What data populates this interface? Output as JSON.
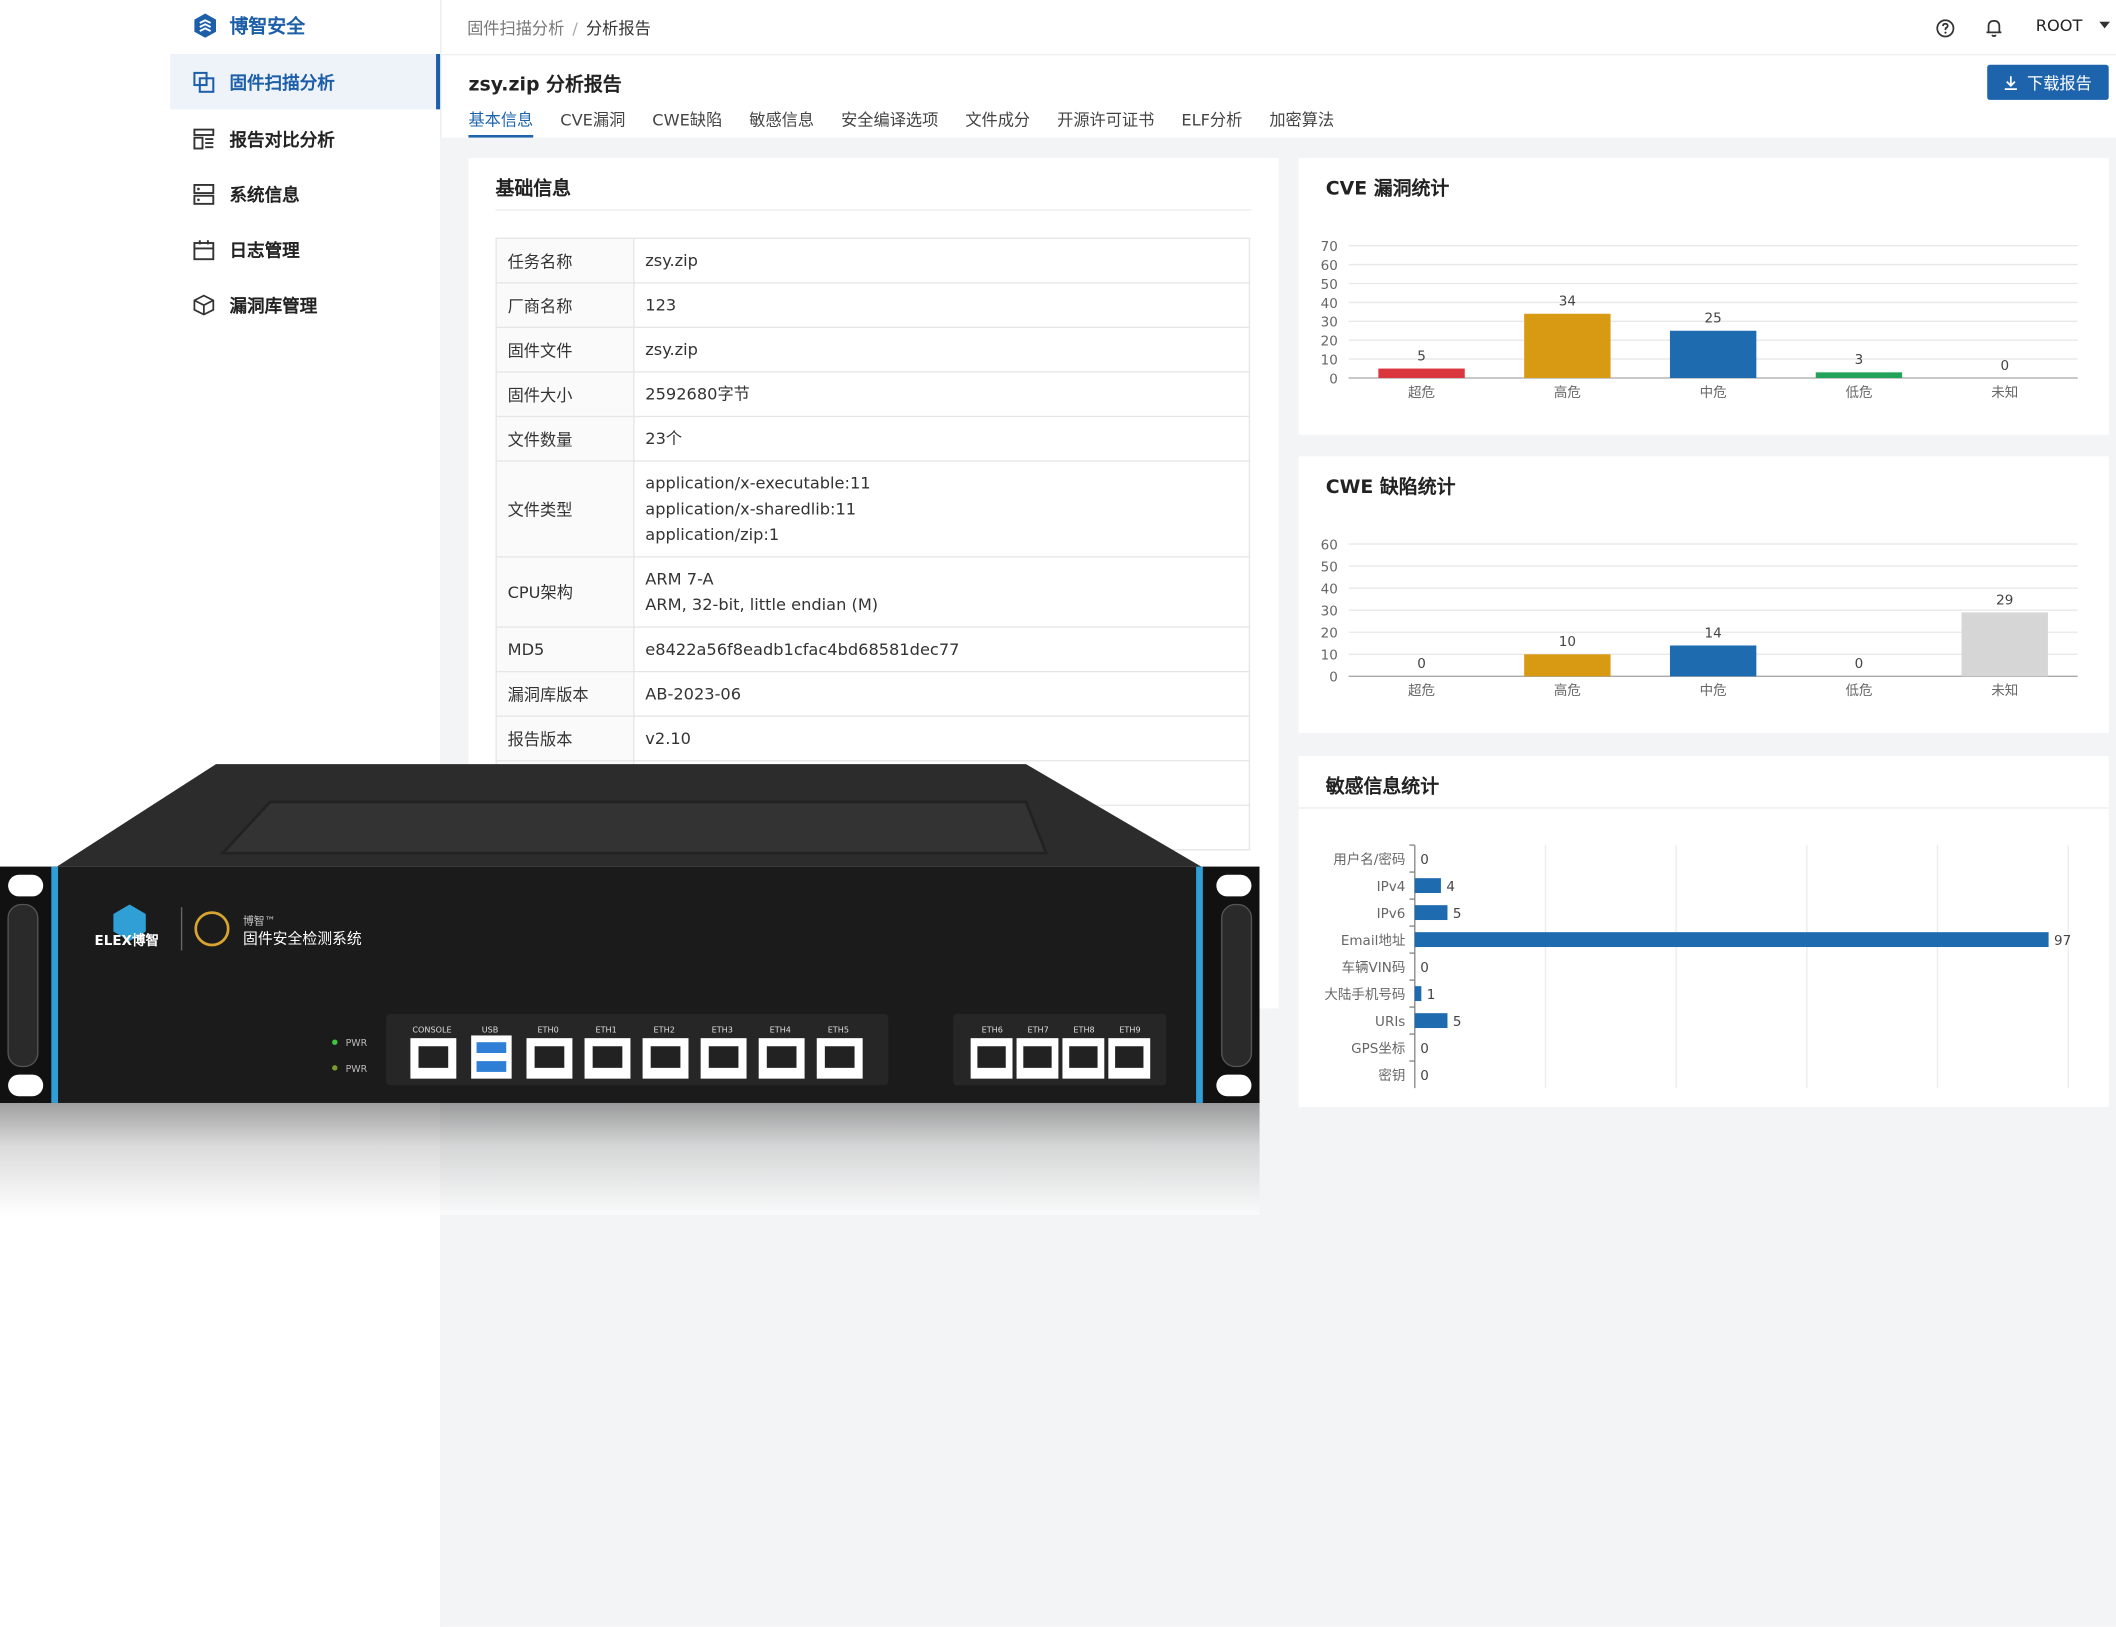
{
  "app": {
    "name": "博智安全"
  },
  "sidebar": {
    "items": [
      {
        "label": "固件扫描分析",
        "icon": "copy-scan-icon",
        "active": true
      },
      {
        "label": "报告对比分析",
        "icon": "report-compare-icon",
        "active": false
      },
      {
        "label": "系统信息",
        "icon": "server-icon",
        "active": false
      },
      {
        "label": "日志管理",
        "icon": "calendar-log-icon",
        "active": false
      },
      {
        "label": "漏洞库管理",
        "icon": "cube-database-icon",
        "active": false
      }
    ]
  },
  "header": {
    "breadcrumb": [
      "固件扫描分析",
      "分析报告"
    ],
    "user": "ROOT"
  },
  "report": {
    "title": "zsy.zip 分析报告",
    "download_label": "下载报告",
    "tabs": [
      "基本信息",
      "CVE漏洞",
      "CWE缺陷",
      "敏感信息",
      "安全编译选项",
      "文件成分",
      "开源许可证书",
      "ELF分析",
      "加密算法"
    ],
    "active_tab": "基本信息"
  },
  "basic_info": {
    "title": "基础信息",
    "rows": [
      {
        "key": "任务名称",
        "values": [
          "zsy.zip"
        ]
      },
      {
        "key": "厂商名称",
        "values": [
          "123"
        ]
      },
      {
        "key": "固件文件",
        "values": [
          "zsy.zip"
        ]
      },
      {
        "key": "固件大小",
        "values": [
          "2592680字节"
        ]
      },
      {
        "key": "文件数量",
        "values": [
          "23个"
        ]
      },
      {
        "key": "文件类型",
        "values": [
          "application/x-executable:11",
          "application/x-sharedlib:11",
          "application/zip:1"
        ]
      },
      {
        "key": "CPU架构",
        "values": [
          "ARM 7-A",
          "ARM, 32-bit, little endian (M)"
        ]
      },
      {
        "key": "MD5",
        "values": [
          "e8422a56f8eadb1cfac4bd68581dec77"
        ]
      },
      {
        "key": "漏洞库版本",
        "values": [
          "AB-2023-06"
        ]
      },
      {
        "key": "报告版本",
        "values": [
          "v2.10"
        ]
      }
    ]
  },
  "chart_data": [
    {
      "type": "bar",
      "title": "CVE 漏洞统计",
      "categories": [
        "超危",
        "高危",
        "中危",
        "低危",
        "未知"
      ],
      "values": [
        5,
        34,
        25,
        3,
        0
      ],
      "colors": [
        "#d9363e",
        "#d99a13",
        "#1f6bb0",
        "#23a35a",
        "#cccccc"
      ],
      "ylim": [
        0,
        70
      ],
      "yticks": [
        0,
        10,
        20,
        30,
        40,
        50,
        60,
        70
      ],
      "grid": true
    },
    {
      "type": "bar",
      "title": "CWE 缺陷统计",
      "categories": [
        "超危",
        "高危",
        "中危",
        "低危",
        "未知"
      ],
      "values": [
        0,
        10,
        14,
        0,
        29
      ],
      "colors": [
        "#d9363e",
        "#d99a13",
        "#1f6bb0",
        "#23a35a",
        "#d6d6d6"
      ],
      "ylim": [
        0,
        60
      ],
      "yticks": [
        0,
        10,
        20,
        30,
        40,
        50,
        60
      ],
      "grid": true
    },
    {
      "type": "bar",
      "orientation": "horizontal",
      "title": "敏感信息统计",
      "categories": [
        "用户名/密码",
        "IPv4",
        "IPv6",
        "Email地址",
        "车辆VIN码",
        "大陆手机号码",
        "URIs",
        "GPS坐标",
        "密钥"
      ],
      "values": [
        0,
        4,
        5,
        97,
        0,
        1,
        5,
        0,
        0
      ],
      "colors": [
        "#1f6bb0"
      ],
      "xlim": [
        0,
        100
      ],
      "grid": true
    }
  ],
  "device": {
    "brand": "ELEX博智",
    "brand_small": "博智™",
    "product_name": "固件安全检测系统",
    "led_labels": [
      "PWR",
      "PWR"
    ],
    "port_labels": [
      "CONSOLE",
      "USB",
      "ETH0",
      "ETH1",
      "ETH2",
      "ETH3",
      "ETH4",
      "ETH5"
    ],
    "port_labels_right": [
      "ETH6",
      "ETH7",
      "ETH8",
      "ETH9"
    ],
    "colors": {
      "body": "#1b1b1b",
      "accent": "#2f9fd6",
      "led": "#3ec63e"
    }
  }
}
